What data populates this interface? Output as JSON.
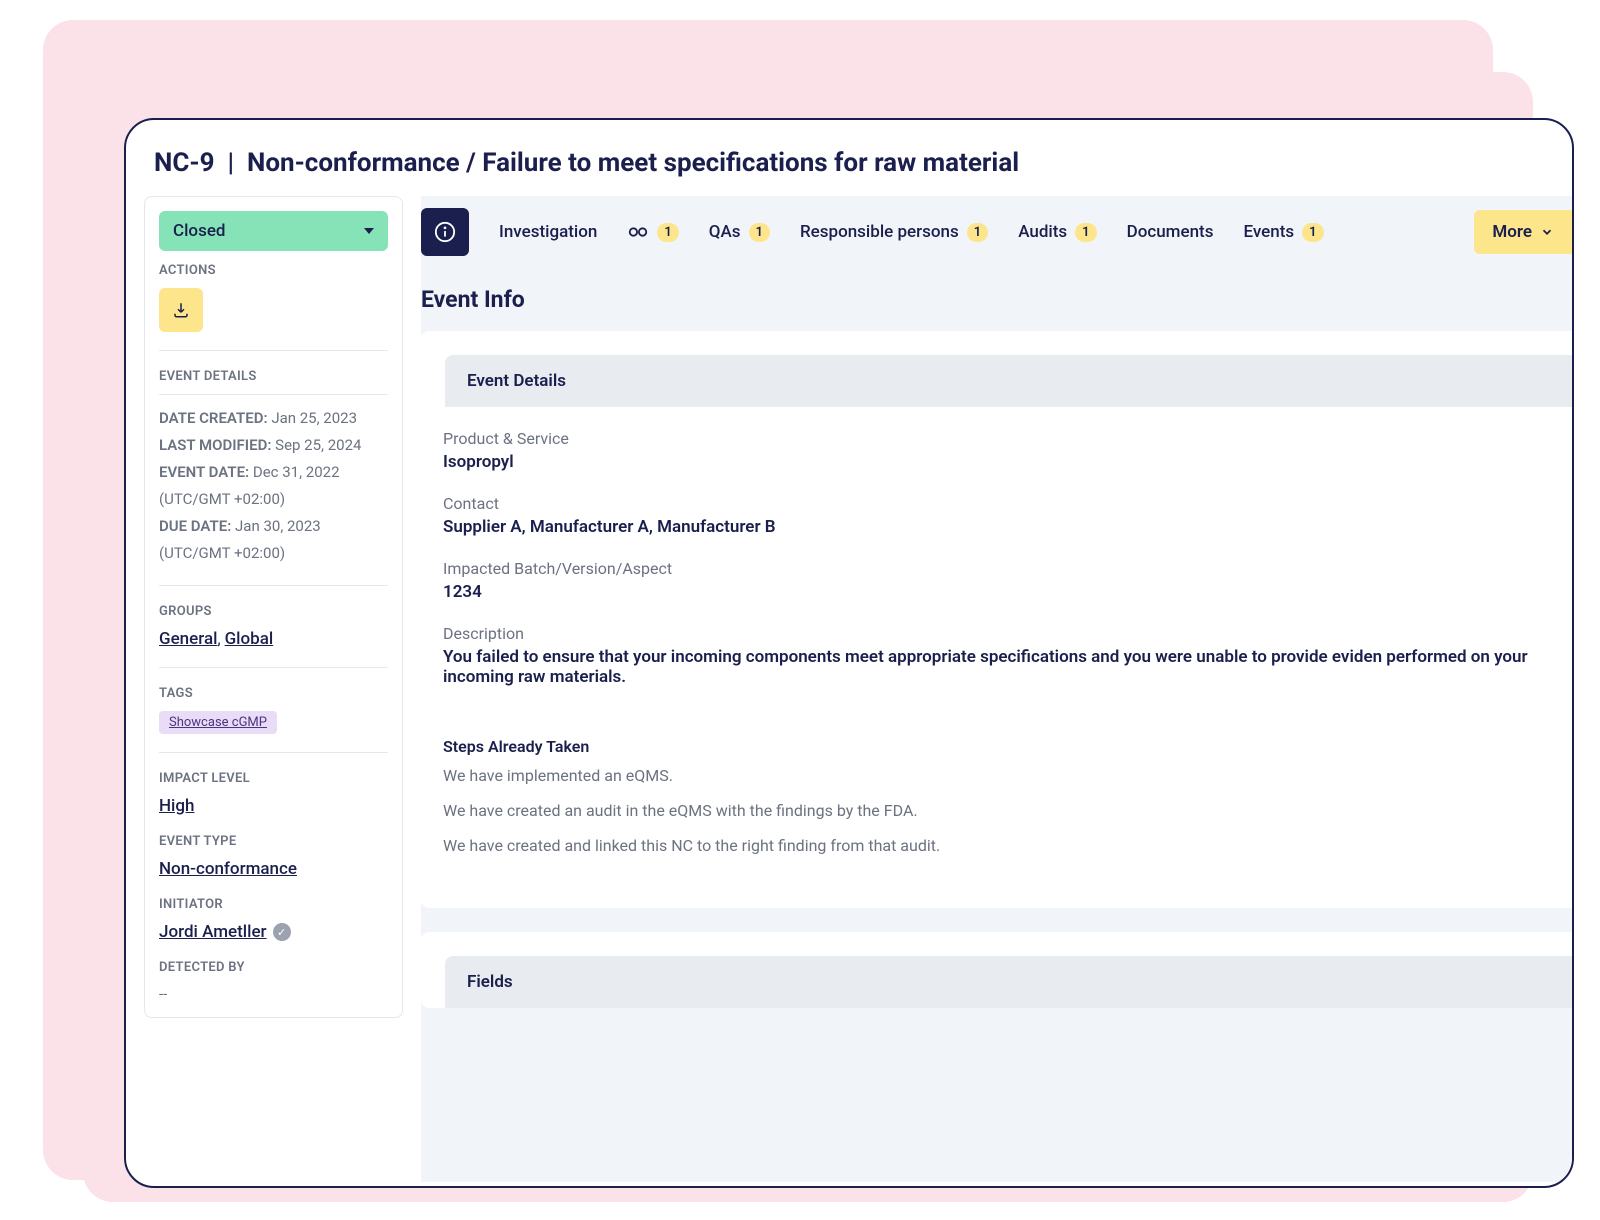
{
  "header": {
    "code": "NC-9",
    "separator": "|",
    "title": "Non-conformance / Failure to meet specifications for raw material"
  },
  "sidebar": {
    "status": "Closed",
    "actions_label": "ACTIONS",
    "event_details_label": "EVENT DETAILS",
    "date_created": {
      "label": "DATE CREATED:",
      "value": "Jan 25, 2023"
    },
    "last_modified": {
      "label": "LAST MODIFIED:",
      "value": "Sep 25, 2024"
    },
    "event_date": {
      "label": "EVENT DATE:",
      "value": "Dec 31, 2022 (UTC/GMT +02:00)"
    },
    "due_date": {
      "label": "DUE DATE:",
      "value": "Jan 30, 2023 (UTC/GMT +02:00)"
    },
    "groups_label": "GROUPS",
    "groups": [
      "General",
      "Global"
    ],
    "tags_label": "TAGS",
    "tags": [
      "Showcase cGMP"
    ],
    "impact_level_label": "IMPACT LEVEL",
    "impact_level": "High",
    "event_type_label": "EVENT TYPE",
    "event_type": "Non-conformance",
    "initiator_label": "INITIATOR",
    "initiator": "Jordi Ametller",
    "detected_by_label": "DETECTED BY",
    "detected_by": "--"
  },
  "tabs": {
    "investigation": "Investigation",
    "link_badge": "1",
    "qas": "QAs",
    "qas_badge": "1",
    "responsible": "Responsible persons",
    "responsible_badge": "1",
    "audits": "Audits",
    "audits_badge": "1",
    "documents": "Documents",
    "events": "Events",
    "events_badge": "1",
    "more": "More"
  },
  "main": {
    "section_title": "Event Info",
    "event_details_header": "Event Details",
    "product_label": "Product & Service",
    "product_value": "Isopropyl",
    "contact_label": "Contact",
    "contact_value": "Supplier A, Manufacturer A, Manufacturer B",
    "batch_label": "Impacted Batch/Version/Aspect",
    "batch_value": "1234",
    "description_label": "Description",
    "description_value": "You failed to ensure that your incoming components meet appropriate specifications and you were unable to provide eviden performed on your incoming raw materials.",
    "steps_label": "Steps Already Taken",
    "steps_1": "We have implemented an eQMS.",
    "steps_2": "We have created an audit in the eQMS with the findings by the FDA.",
    "steps_3": "We have created and linked this NC to the right finding from that audit.",
    "fields_header": "Fields"
  }
}
